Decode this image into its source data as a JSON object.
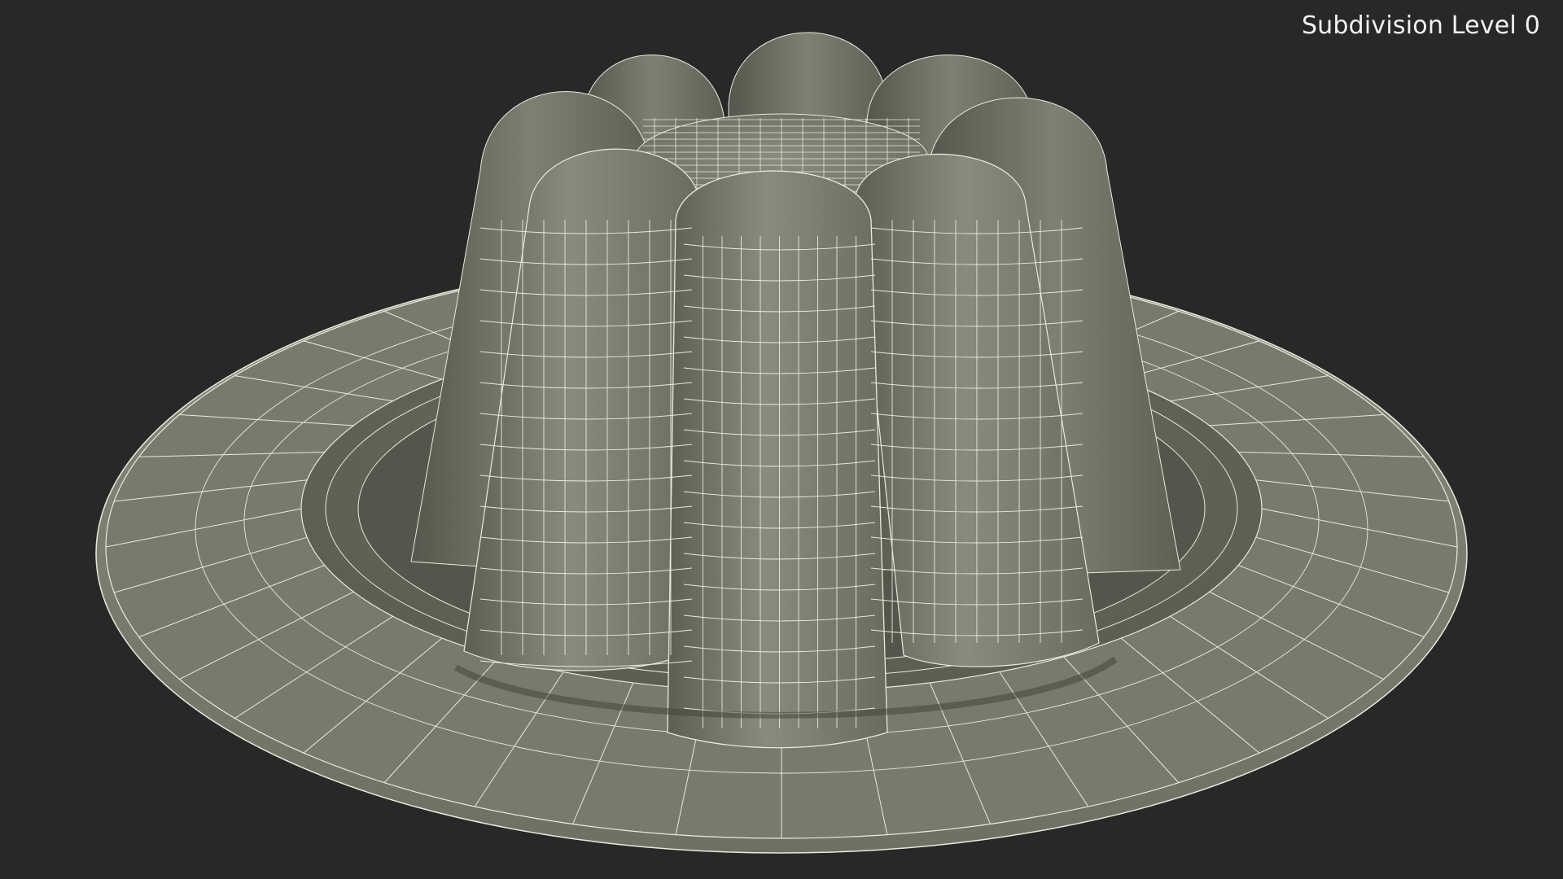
{
  "viewport": {
    "overlay_label": "Subdivision Level 0",
    "background_color": "#282828",
    "surface_color": "#7a7a6c",
    "wireframe_color": "#e9e9dc"
  },
  "scene": {
    "object": "jelly pudding on plate",
    "render_style": "shaded wireframe",
    "subdivision_level": 0
  }
}
